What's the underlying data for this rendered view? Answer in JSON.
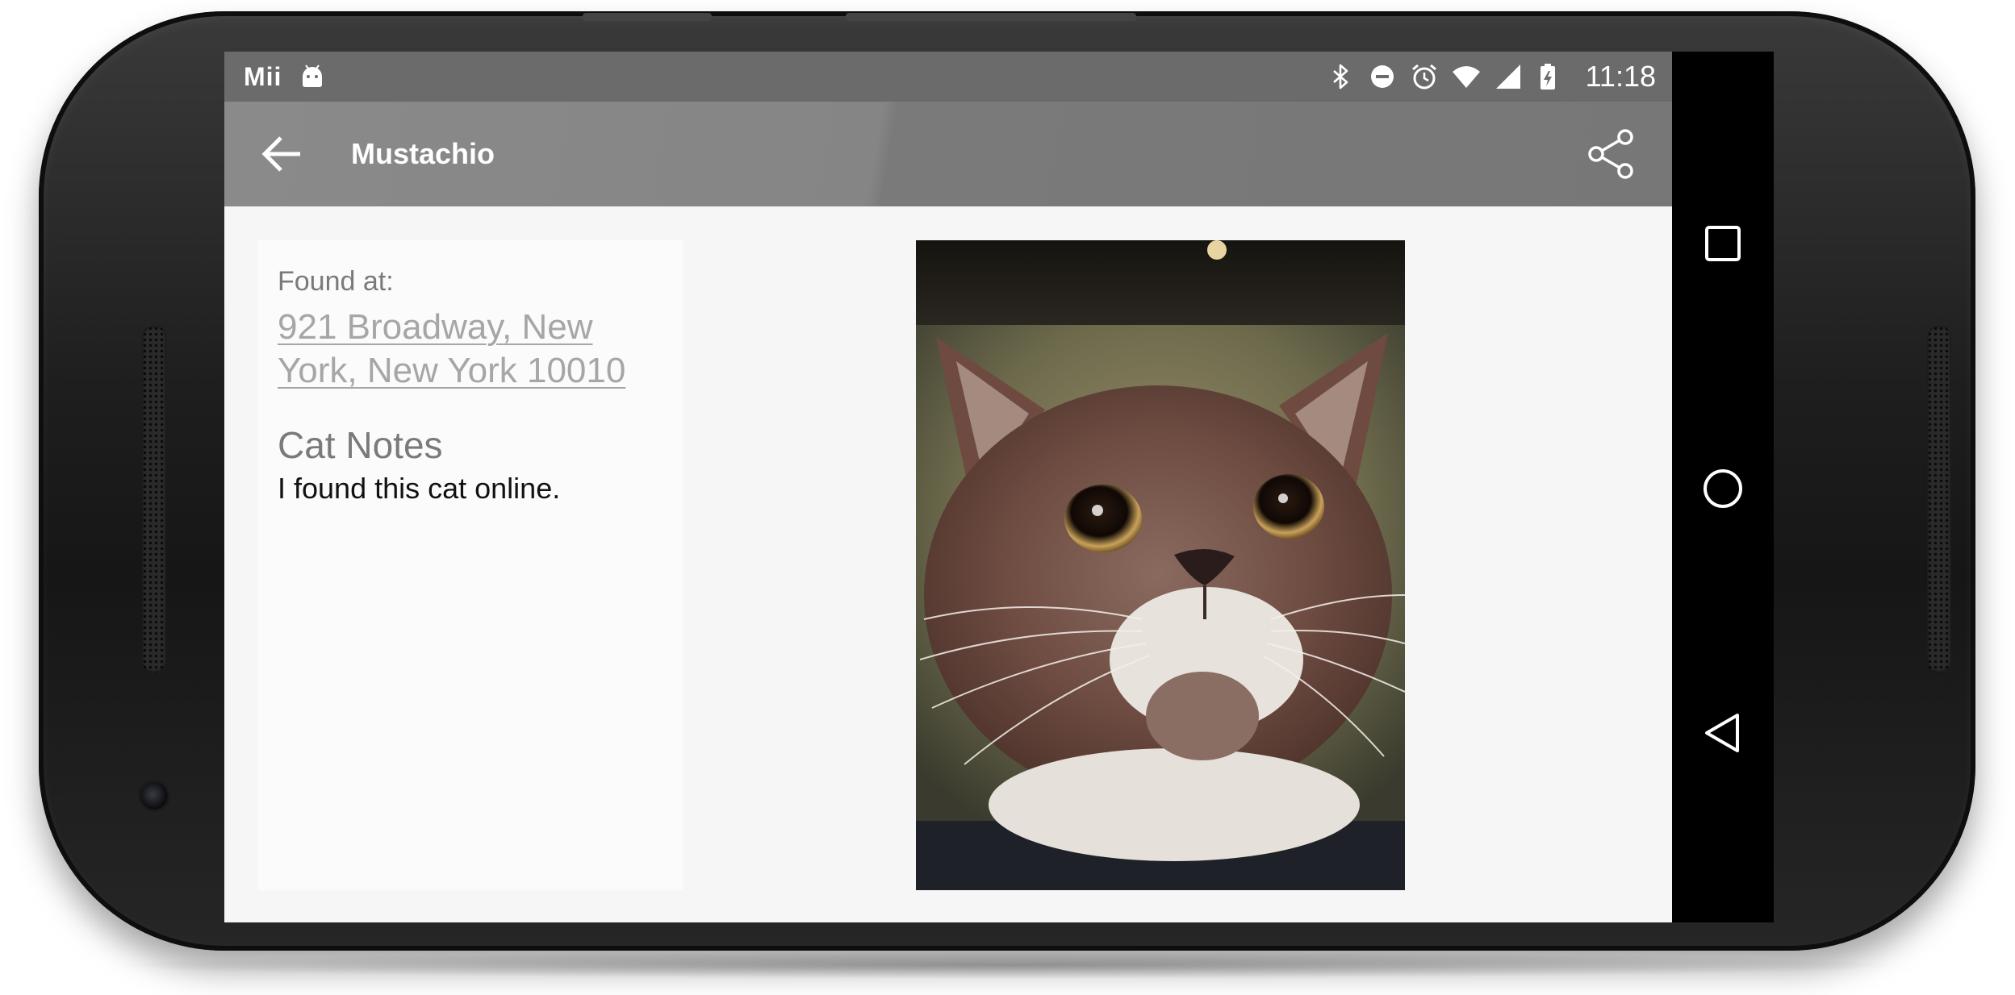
{
  "status_bar": {
    "carrier": "Mii",
    "time": "11:18",
    "icons": [
      "android-debug-icon",
      "bluetooth-icon",
      "do-not-disturb-icon",
      "alarm-icon",
      "wifi-icon",
      "cell-signal-icon",
      "battery-charging-icon"
    ]
  },
  "toolbar": {
    "title": "Mustachio",
    "back_icon": "arrow-back-icon",
    "share_icon": "share-icon"
  },
  "detail": {
    "found_label": "Found at:",
    "address": "921 Broadway, New York, New York 10010",
    "notes_heading": "Cat Notes",
    "notes_body": "I found this cat online."
  },
  "photo": {
    "subject": "cat-photo"
  },
  "nav_bar": {
    "buttons": [
      "recents-icon",
      "home-icon",
      "back-icon"
    ]
  },
  "colors": {
    "toolbar": "#858585",
    "status_bar": "#6b6b6b",
    "link": "#a6a6a6",
    "background": "#f6f6f6"
  }
}
